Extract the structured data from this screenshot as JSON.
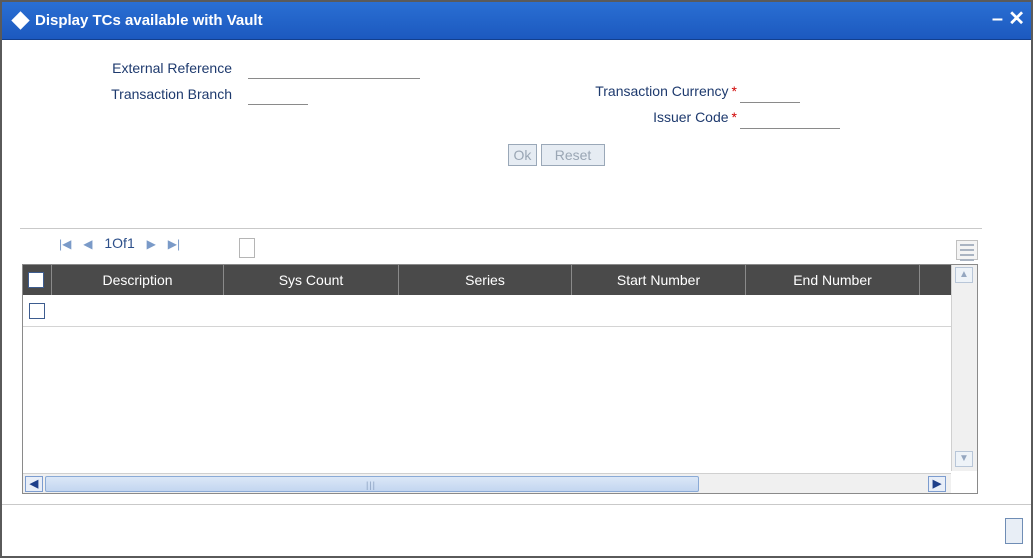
{
  "window": {
    "title": "Display TCs available with Vault"
  },
  "form": {
    "external_reference_label": "External Reference",
    "external_reference_value": "",
    "transaction_branch_label": "Transaction Branch",
    "transaction_branch_value": "",
    "transaction_currency_label": "Transaction Currency",
    "transaction_currency_value": "",
    "issuer_code_label": "Issuer Code",
    "issuer_code_value": "",
    "required_marker": "*"
  },
  "buttons": {
    "ok_label": "Ok",
    "reset_label": "Reset"
  },
  "pager": {
    "page_text": "1Of1"
  },
  "table": {
    "columns": [
      "Description",
      "Sys Count",
      "Series",
      "Start Number",
      "End Number"
    ],
    "rows": [
      {
        "description": "",
        "sys_count": "",
        "series": "",
        "start_number": "",
        "end_number": ""
      }
    ]
  }
}
